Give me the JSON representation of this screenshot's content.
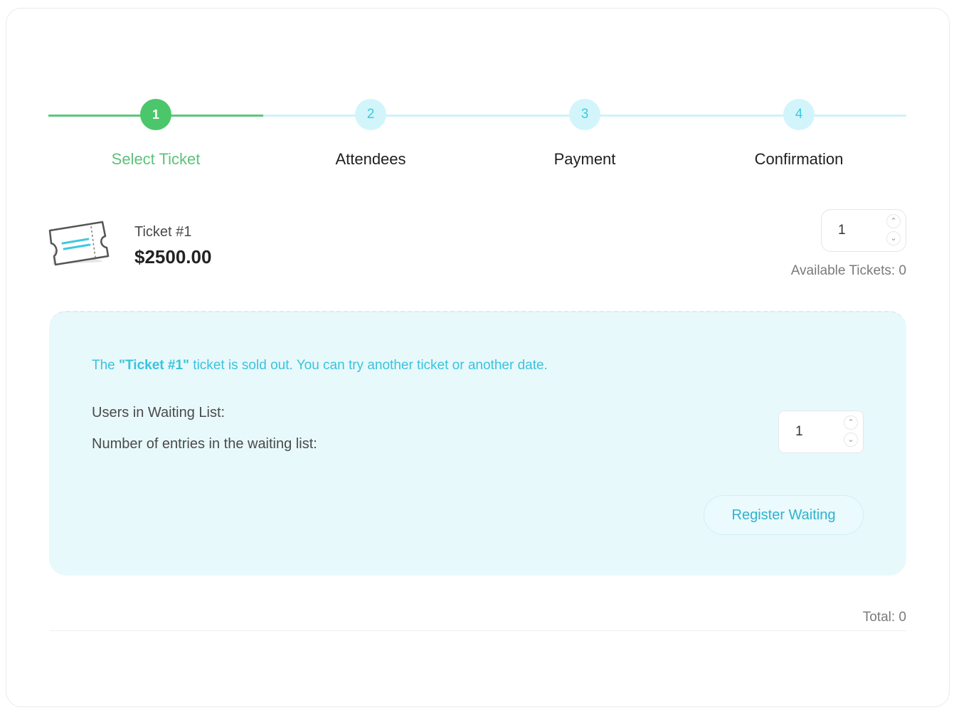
{
  "stepper": {
    "steps": [
      {
        "number": "1",
        "label": "Select Ticket",
        "state": "active"
      },
      {
        "number": "2",
        "label": "Attendees",
        "state": "pending"
      },
      {
        "number": "3",
        "label": "Payment",
        "state": "pending"
      },
      {
        "number": "4",
        "label": "Confirmation",
        "state": "pending"
      }
    ],
    "active_color": "#4cc66a",
    "pending_color": "#d2f5fb"
  },
  "ticket": {
    "icon": "ticket-icon",
    "name": "Ticket #1",
    "price": "$2500.00",
    "quantity": "1",
    "available_text": "Available Tickets: 0"
  },
  "waiting": {
    "soldout_prefix": "The ",
    "soldout_ticket": "\"Ticket #1\"",
    "soldout_suffix": " ticket is sold out. You can try another ticket or another date.",
    "users_label": "Users in Waiting List:",
    "entries_label": "Number of entries in the waiting list:",
    "entries_value": "1",
    "register_button": "Register Waiting",
    "accent_color": "#39c3dd"
  },
  "summary": {
    "total_text": "Total: 0"
  },
  "icons": {
    "up": "chevron-up-icon",
    "down": "chevron-down-icon"
  }
}
